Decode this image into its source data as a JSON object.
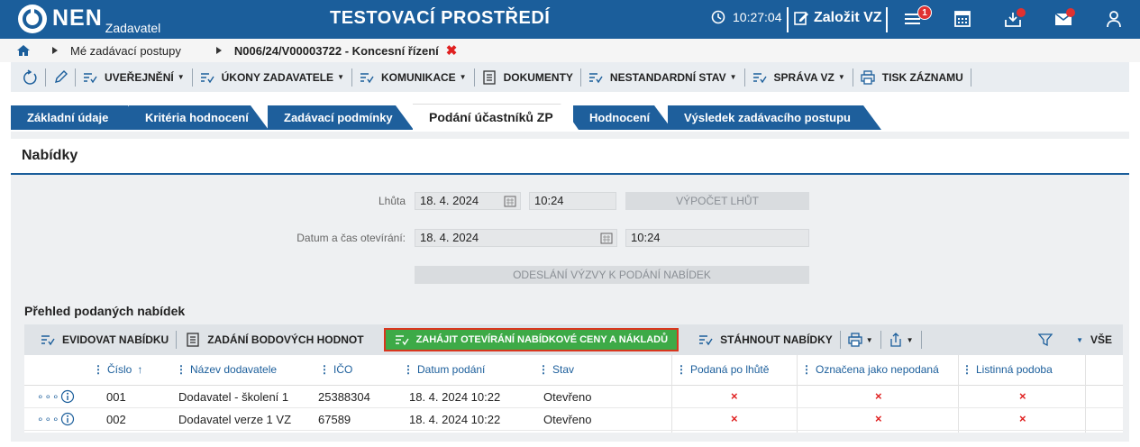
{
  "header": {
    "logo_text": "NEN",
    "logo_sub": "Zadavatel",
    "env_title": "TESTOVACÍ PROSTŘEDÍ",
    "time": "10:27:04",
    "create_label": "Založit VZ",
    "notifications_count": "1",
    "brand_color": "#1b5e9b"
  },
  "breadcrumb": {
    "items": [
      "Mé zadávací postupy",
      "N006/24/V00003722 - Koncesní řízení"
    ]
  },
  "toolbar": {
    "items": [
      {
        "label": "UVEŘEJNĚNÍ"
      },
      {
        "label": "ÚKONY ZADAVATELE"
      },
      {
        "label": "KOMUNIKACE"
      },
      {
        "label": "DOKUMENTY"
      },
      {
        "label": "NESTANDARDNÍ STAV"
      },
      {
        "label": "SPRÁVA VZ"
      },
      {
        "label": "TISK ZÁZNAMU"
      }
    ]
  },
  "tabs": [
    {
      "label": "Základní údaje"
    },
    {
      "label": "Kritéria hodnocení"
    },
    {
      "label": "Zadávací podmínky"
    },
    {
      "label": "Podání účastníků ZP"
    },
    {
      "label": "Hodnocení"
    },
    {
      "label": "Výsledek zadávacího postupu"
    }
  ],
  "panel": {
    "title": "Nabídky",
    "deadline_label": "Lhůta",
    "deadline_date": "18. 4. 2024",
    "deadline_time": "10:24",
    "calc_button": "VÝPOČET LHŮT",
    "opening_label": "Datum a čas otevírání:",
    "opening_date": "18. 4. 2024",
    "opening_time": "10:24",
    "send_button": "ODESLÁNÍ VÝZVY K PODÁNÍ NABÍDEK"
  },
  "offers": {
    "title": "Přehled podaných nabídek",
    "toolbar": {
      "record": "EVIDOVAT NABÍDKU",
      "points": "ZADÁNÍ BODOVÝCH HODNOT",
      "open_prices": "ZAHÁJIT OTEVÍRÁNÍ NABÍDKOVÉ CENY A NÁKLADŮ",
      "download": "STÁHNOUT NABÍDKY",
      "all": "VŠE"
    },
    "columns": [
      "Číslo",
      "Název dodavatele",
      "IČO",
      "Datum podání",
      "Stav",
      "Podaná po lhůtě",
      "Označena jako nepodaná",
      "Listinná podoba"
    ],
    "rows": [
      {
        "number": "001",
        "supplier": "Dodavatel - školení 1",
        "ico": "25388304",
        "date": "18. 4. 2024 10:22",
        "status": "Otevřeno",
        "late": "×",
        "not_submitted": "×",
        "paper": "×"
      },
      {
        "number": "002",
        "supplier": "Dodavatel verze 1 VZ",
        "ico": "67589",
        "date": "18. 4. 2024 10:22",
        "status": "Otevřeno",
        "late": "×",
        "not_submitted": "×",
        "paper": "×"
      }
    ]
  }
}
